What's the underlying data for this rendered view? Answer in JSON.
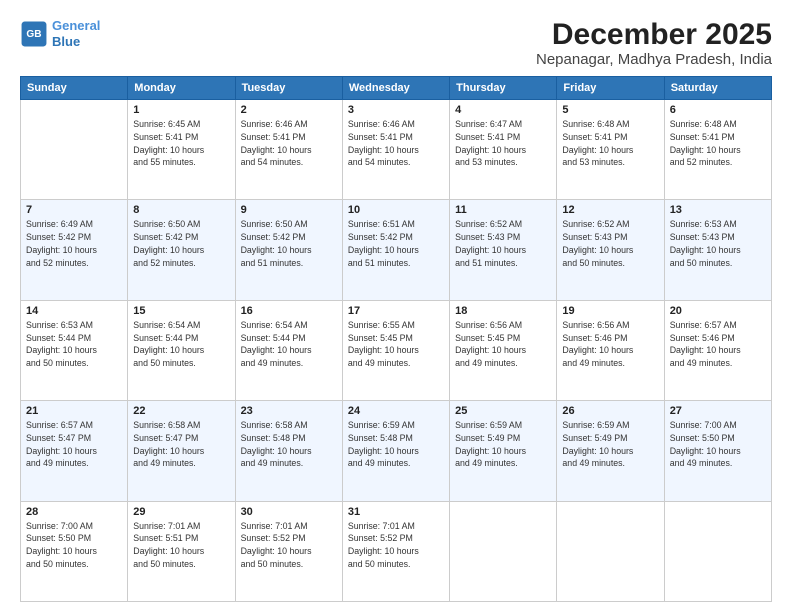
{
  "header": {
    "logo_line1": "General",
    "logo_line2": "Blue",
    "title": "December 2025",
    "subtitle": "Nepanagar, Madhya Pradesh, India"
  },
  "days_of_week": [
    "Sunday",
    "Monday",
    "Tuesday",
    "Wednesday",
    "Thursday",
    "Friday",
    "Saturday"
  ],
  "weeks": [
    [
      {
        "day": "",
        "detail": ""
      },
      {
        "day": "1",
        "detail": "Sunrise: 6:45 AM\nSunset: 5:41 PM\nDaylight: 10 hours\nand 55 minutes."
      },
      {
        "day": "2",
        "detail": "Sunrise: 6:46 AM\nSunset: 5:41 PM\nDaylight: 10 hours\nand 54 minutes."
      },
      {
        "day": "3",
        "detail": "Sunrise: 6:46 AM\nSunset: 5:41 PM\nDaylight: 10 hours\nand 54 minutes."
      },
      {
        "day": "4",
        "detail": "Sunrise: 6:47 AM\nSunset: 5:41 PM\nDaylight: 10 hours\nand 53 minutes."
      },
      {
        "day": "5",
        "detail": "Sunrise: 6:48 AM\nSunset: 5:41 PM\nDaylight: 10 hours\nand 53 minutes."
      },
      {
        "day": "6",
        "detail": "Sunrise: 6:48 AM\nSunset: 5:41 PM\nDaylight: 10 hours\nand 52 minutes."
      }
    ],
    [
      {
        "day": "7",
        "detail": "Sunrise: 6:49 AM\nSunset: 5:42 PM\nDaylight: 10 hours\nand 52 minutes."
      },
      {
        "day": "8",
        "detail": "Sunrise: 6:50 AM\nSunset: 5:42 PM\nDaylight: 10 hours\nand 52 minutes."
      },
      {
        "day": "9",
        "detail": "Sunrise: 6:50 AM\nSunset: 5:42 PM\nDaylight: 10 hours\nand 51 minutes."
      },
      {
        "day": "10",
        "detail": "Sunrise: 6:51 AM\nSunset: 5:42 PM\nDaylight: 10 hours\nand 51 minutes."
      },
      {
        "day": "11",
        "detail": "Sunrise: 6:52 AM\nSunset: 5:43 PM\nDaylight: 10 hours\nand 51 minutes."
      },
      {
        "day": "12",
        "detail": "Sunrise: 6:52 AM\nSunset: 5:43 PM\nDaylight: 10 hours\nand 50 minutes."
      },
      {
        "day": "13",
        "detail": "Sunrise: 6:53 AM\nSunset: 5:43 PM\nDaylight: 10 hours\nand 50 minutes."
      }
    ],
    [
      {
        "day": "14",
        "detail": "Sunrise: 6:53 AM\nSunset: 5:44 PM\nDaylight: 10 hours\nand 50 minutes."
      },
      {
        "day": "15",
        "detail": "Sunrise: 6:54 AM\nSunset: 5:44 PM\nDaylight: 10 hours\nand 50 minutes."
      },
      {
        "day": "16",
        "detail": "Sunrise: 6:54 AM\nSunset: 5:44 PM\nDaylight: 10 hours\nand 49 minutes."
      },
      {
        "day": "17",
        "detail": "Sunrise: 6:55 AM\nSunset: 5:45 PM\nDaylight: 10 hours\nand 49 minutes."
      },
      {
        "day": "18",
        "detail": "Sunrise: 6:56 AM\nSunset: 5:45 PM\nDaylight: 10 hours\nand 49 minutes."
      },
      {
        "day": "19",
        "detail": "Sunrise: 6:56 AM\nSunset: 5:46 PM\nDaylight: 10 hours\nand 49 minutes."
      },
      {
        "day": "20",
        "detail": "Sunrise: 6:57 AM\nSunset: 5:46 PM\nDaylight: 10 hours\nand 49 minutes."
      }
    ],
    [
      {
        "day": "21",
        "detail": "Sunrise: 6:57 AM\nSunset: 5:47 PM\nDaylight: 10 hours\nand 49 minutes."
      },
      {
        "day": "22",
        "detail": "Sunrise: 6:58 AM\nSunset: 5:47 PM\nDaylight: 10 hours\nand 49 minutes."
      },
      {
        "day": "23",
        "detail": "Sunrise: 6:58 AM\nSunset: 5:48 PM\nDaylight: 10 hours\nand 49 minutes."
      },
      {
        "day": "24",
        "detail": "Sunrise: 6:59 AM\nSunset: 5:48 PM\nDaylight: 10 hours\nand 49 minutes."
      },
      {
        "day": "25",
        "detail": "Sunrise: 6:59 AM\nSunset: 5:49 PM\nDaylight: 10 hours\nand 49 minutes."
      },
      {
        "day": "26",
        "detail": "Sunrise: 6:59 AM\nSunset: 5:49 PM\nDaylight: 10 hours\nand 49 minutes."
      },
      {
        "day": "27",
        "detail": "Sunrise: 7:00 AM\nSunset: 5:50 PM\nDaylight: 10 hours\nand 49 minutes."
      }
    ],
    [
      {
        "day": "28",
        "detail": "Sunrise: 7:00 AM\nSunset: 5:50 PM\nDaylight: 10 hours\nand 50 minutes."
      },
      {
        "day": "29",
        "detail": "Sunrise: 7:01 AM\nSunset: 5:51 PM\nDaylight: 10 hours\nand 50 minutes."
      },
      {
        "day": "30",
        "detail": "Sunrise: 7:01 AM\nSunset: 5:52 PM\nDaylight: 10 hours\nand 50 minutes."
      },
      {
        "day": "31",
        "detail": "Sunrise: 7:01 AM\nSunset: 5:52 PM\nDaylight: 10 hours\nand 50 minutes."
      },
      {
        "day": "",
        "detail": ""
      },
      {
        "day": "",
        "detail": ""
      },
      {
        "day": "",
        "detail": ""
      }
    ]
  ]
}
